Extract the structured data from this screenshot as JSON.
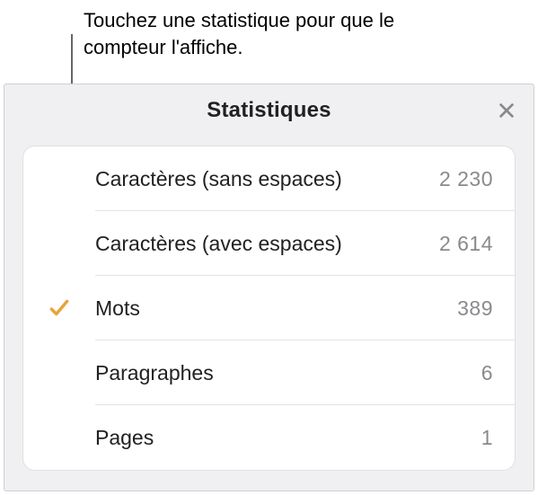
{
  "callout": {
    "text": "Touchez une statistique pour que le compteur l'affiche."
  },
  "panel": {
    "title": "Statistiques",
    "close_icon": "close-icon"
  },
  "stats": [
    {
      "label": "Caractères (sans espaces)",
      "value": "2 230",
      "selected": false
    },
    {
      "label": "Caractères (avec espaces)",
      "value": "2 614",
      "selected": false
    },
    {
      "label": "Mots",
      "value": "389",
      "selected": true
    },
    {
      "label": "Paragraphes",
      "value": "6",
      "selected": false
    },
    {
      "label": "Pages",
      "value": "1",
      "selected": false
    }
  ]
}
